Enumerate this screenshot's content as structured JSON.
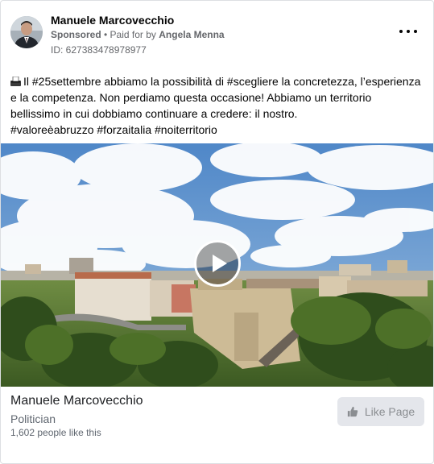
{
  "post": {
    "author": "Manuele Marcovecchio",
    "sponsored_label": "Sponsored",
    "separator": " • ",
    "paid_for_prefix": "Paid for by ",
    "paid_for_name": "Angela Menna",
    "ad_id": "ID: 627383478978977",
    "text_lines": [
      "Il #25settembre abbiamo la possibilità di #scegliere la concretezza, l’esperienza",
      "e la competenza. Non perdiamo questa occasione! Abbiamo un territorio",
      "bellissimo in cui dobbiamo continuare a credere: il nostro.",
      "#valoreèabruzzo #forzaitalia #noiterritorio"
    ]
  },
  "page_footer": {
    "name": "Manuele Marcovecchio",
    "category": "Politician",
    "likes": "1,602 people like this",
    "like_button_label": "Like Page"
  },
  "icons": {
    "more": "more-options-icon",
    "play": "play-icon",
    "like": "thumbs-up-icon",
    "emoji": "ballot-box-emoji-icon"
  }
}
